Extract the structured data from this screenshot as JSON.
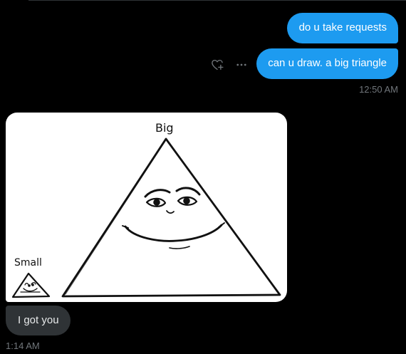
{
  "messages": [
    {
      "direction": "sent",
      "text": "do u take requests"
    },
    {
      "direction": "sent",
      "text": "can u draw. a big triangle"
    },
    {
      "direction": "received",
      "attachment": "drawing",
      "drawing_labels": {
        "big": "Big",
        "small": "Small"
      }
    },
    {
      "direction": "received",
      "text": "I got you"
    }
  ],
  "timestamps": {
    "sent_group": "12:50 AM",
    "received_group": "1:14 AM"
  },
  "actions": {
    "react_icon": "heart-plus-icon",
    "more_icon": "more-icon"
  },
  "colors": {
    "background": "#000000",
    "sent_bubble": "#1d9bf0",
    "received_bubble": "#2f3336",
    "muted_text": "#71767b"
  }
}
